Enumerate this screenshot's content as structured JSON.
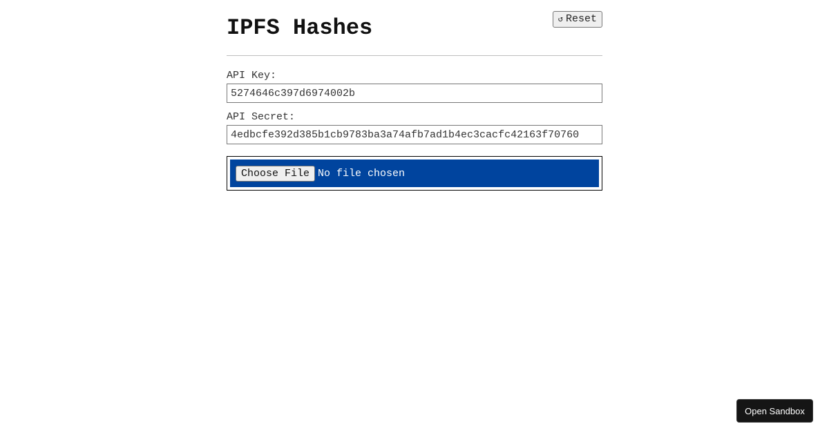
{
  "header": {
    "title": "IPFS Hashes",
    "reset_label": "Reset",
    "reset_icon": "↺"
  },
  "form": {
    "api_key": {
      "label": "API Key:",
      "value": "5274646c397d6974002b"
    },
    "api_secret": {
      "label": "API Secret:",
      "value": "4edbcfe392d385b1cb9783ba3a74afb7ad1b4ec3cacfc42163f70760"
    },
    "file": {
      "button_label": "Choose File",
      "status": "No file chosen"
    }
  },
  "footer": {
    "sandbox_label": "Open Sandbox"
  },
  "colors": {
    "file_panel_bg": "#00449e",
    "sandbox_button_bg": "#151515"
  }
}
